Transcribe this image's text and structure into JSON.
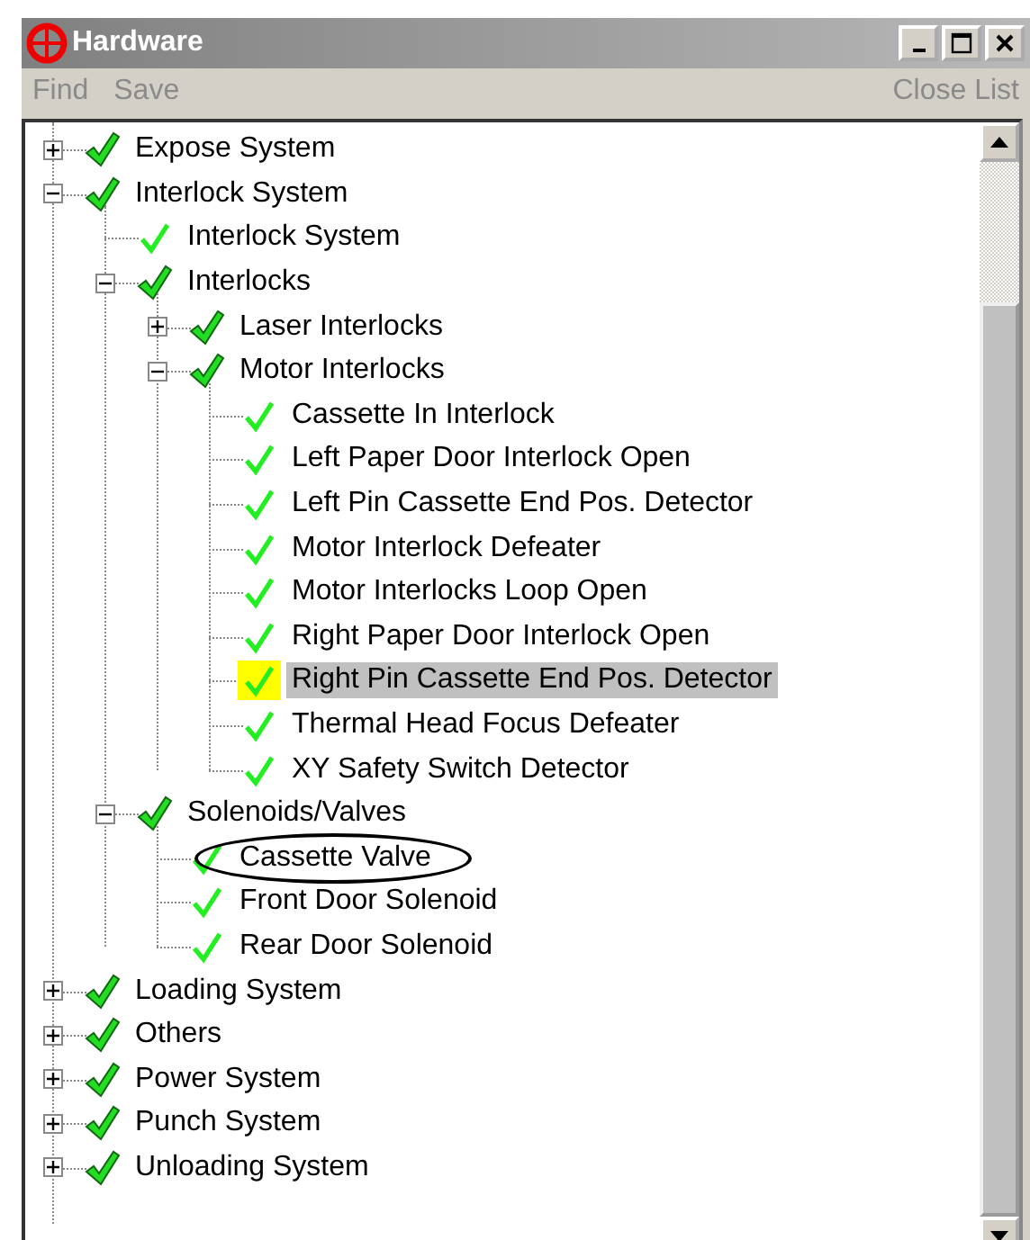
{
  "window": {
    "title": "Hardware"
  },
  "menu": [
    {
      "label": "Find",
      "disabled": true
    },
    {
      "label": "Save",
      "disabled": true
    },
    {
      "label": "Close List",
      "disabled": true
    }
  ],
  "tree": [
    {
      "label": "Expose System",
      "kind": "group",
      "expanded": false,
      "selected": false,
      "circled": false
    },
    {
      "label": "Interlock System",
      "kind": "group",
      "expanded": true,
      "selected": false,
      "circled": false,
      "children": [
        {
          "label": "Interlock System",
          "kind": "leaf",
          "selected": false,
          "circled": false
        },
        {
          "label": "Interlocks",
          "kind": "group",
          "expanded": true,
          "selected": false,
          "circled": false,
          "children": [
            {
              "label": "Laser Interlocks",
              "kind": "group",
              "expanded": false,
              "selected": false,
              "circled": false
            },
            {
              "label": "Motor Interlocks",
              "kind": "group",
              "expanded": true,
              "selected": false,
              "circled": false,
              "children": [
                {
                  "label": "Cassette In Interlock",
                  "kind": "leaf",
                  "selected": false,
                  "circled": false
                },
                {
                  "label": "Left Paper Door Interlock Open",
                  "kind": "leaf",
                  "selected": false,
                  "circled": false
                },
                {
                  "label": "Left Pin Cassette End Pos. Detector",
                  "kind": "leaf",
                  "selected": false,
                  "circled": false
                },
                {
                  "label": "Motor Interlock Defeater",
                  "kind": "leaf",
                  "selected": false,
                  "circled": false
                },
                {
                  "label": "Motor Interlocks Loop Open",
                  "kind": "leaf",
                  "selected": false,
                  "circled": false
                },
                {
                  "label": "Right Paper Door Interlock Open",
                  "kind": "leaf",
                  "selected": false,
                  "circled": false
                },
                {
                  "label": "Right Pin Cassette End Pos. Detector",
                  "kind": "leaf",
                  "selected": true,
                  "circled": false
                },
                {
                  "label": "Thermal Head Focus Defeater",
                  "kind": "leaf",
                  "selected": false,
                  "circled": false
                },
                {
                  "label": "XY Safety Switch Detector",
                  "kind": "leaf",
                  "selected": false,
                  "circled": false
                }
              ]
            }
          ]
        },
        {
          "label": "Solenoids/Valves",
          "kind": "group",
          "expanded": true,
          "selected": false,
          "circled": false,
          "children": [
            {
              "label": "Cassette Valve",
              "kind": "leaf",
              "selected": false,
              "circled": true
            },
            {
              "label": "Front Door Solenoid",
              "kind": "leaf",
              "selected": false,
              "circled": false
            },
            {
              "label": "Rear Door Solenoid",
              "kind": "leaf",
              "selected": false,
              "circled": false
            }
          ]
        }
      ]
    },
    {
      "label": "Loading System",
      "kind": "group",
      "expanded": false,
      "selected": false,
      "circled": false
    },
    {
      "label": "Others",
      "kind": "group",
      "expanded": false,
      "selected": false,
      "circled": false
    },
    {
      "label": "Power System",
      "kind": "group",
      "expanded": false,
      "selected": false,
      "circled": false
    },
    {
      "label": "Punch System",
      "kind": "group",
      "expanded": false,
      "selected": false,
      "circled": false
    },
    {
      "label": "Unloading System",
      "kind": "group",
      "expanded": false,
      "selected": false,
      "circled": false
    }
  ]
}
